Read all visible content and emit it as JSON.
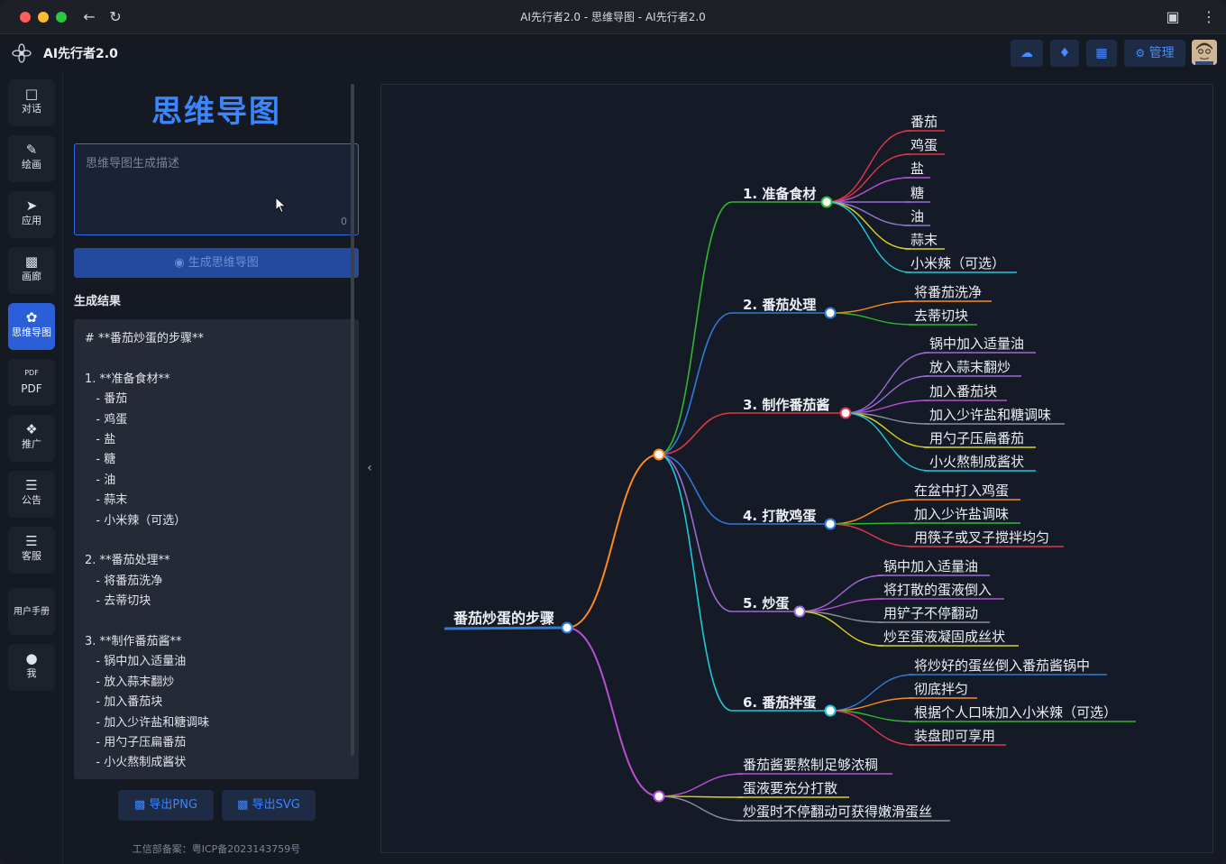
{
  "window": {
    "title": "AI先行者2.0 - 思维导图 - AI先行者2.0"
  },
  "app": {
    "name": "AI先行者2.0",
    "manage_label": "管理"
  },
  "nav": [
    {
      "label": "对话",
      "icon": "chat-icon"
    },
    {
      "label": "绘画",
      "icon": "brush-icon"
    },
    {
      "label": "应用",
      "icon": "rocket-icon"
    },
    {
      "label": "画廊",
      "icon": "gallery-icon"
    },
    {
      "label": "思维导图",
      "icon": "mindmap-icon",
      "active": true
    },
    {
      "label": "PDF",
      "icon": "pdf-icon"
    },
    {
      "label": "推广",
      "icon": "handshake-icon"
    },
    {
      "label": "公告",
      "icon": "notice-icon"
    },
    {
      "label": "客服",
      "icon": "service-icon"
    },
    {
      "label": "用户手册",
      "icon": "manual-icon"
    },
    {
      "label": "我",
      "icon": "user-icon"
    }
  ],
  "panel": {
    "title": "思维导图",
    "input_placeholder": "思维导图生成描述",
    "input_count": "0",
    "generate_label": "生成思维导图",
    "result_label": "生成结果",
    "result_lines": [
      "# **番茄炒蛋的步骤**",
      "",
      "1. **准备食材**",
      "   - 番茄",
      "   - 鸡蛋",
      "   - 盐",
      "   - 糖",
      "   - 油",
      "   - 蒜末",
      "   - 小米辣（可选）",
      "",
      "2. **番茄处理**",
      "   - 将番茄洗净",
      "   - 去蒂切块",
      "",
      "3. **制作番茄酱**",
      "   - 锅中加入适量油",
      "   - 放入蒜末翻炒",
      "   - 加入番茄块",
      "   - 加入少许盐和糖调味",
      "   - 用勺子压扁番茄",
      "   - 小火熬制成酱状"
    ],
    "export_png": "导出PNG",
    "export_svg": "导出SVG",
    "icp": "工信部备案：粤ICP备2023143759号"
  },
  "mindmap": {
    "root": "番茄炒蛋的步骤",
    "branches": [
      {
        "label": "1. 准备食材",
        "color": "#2eb82e",
        "children": [
          {
            "label": "番茄",
            "color": "#e0364a"
          },
          {
            "label": "鸡蛋",
            "color": "#e0364a"
          },
          {
            "label": "盐",
            "color": "#b84fd1"
          },
          {
            "label": "糖",
            "color": "#9a6bd6"
          },
          {
            "label": "油",
            "color": "#8c7ad0"
          },
          {
            "label": "蒜末",
            "color": "#d8d21e"
          },
          {
            "label": "小米辣（可选）",
            "color": "#1ec8d8"
          }
        ]
      },
      {
        "label": "2. 番茄处理",
        "color": "#2f7bd6",
        "children": [
          {
            "label": "将番茄洗净",
            "color": "#ff8a1e"
          },
          {
            "label": "去蒂切块",
            "color": "#2eb82e"
          }
        ]
      },
      {
        "label": "3. 制作番茄酱",
        "color": "#e0364a",
        "children": [
          {
            "label": "锅中加入适量油",
            "color": "#9a6bd6"
          },
          {
            "label": "放入蒜末翻炒",
            "color": "#9a6bd6"
          },
          {
            "label": "加入番茄块",
            "color": "#b84fd1"
          },
          {
            "label": "加入少许盐和糖调味",
            "color": "#8c8c99"
          },
          {
            "label": "用勺子压扁番茄",
            "color": "#d8d21e"
          },
          {
            "label": "小火熬制成酱状",
            "color": "#1ec8d8"
          }
        ]
      },
      {
        "label": "4. 打散鸡蛋",
        "color": "#2f7bd6",
        "children": [
          {
            "label": "在盆中打入鸡蛋",
            "color": "#ff8a1e"
          },
          {
            "label": "加入少许盐调味",
            "color": "#2eb82e"
          },
          {
            "label": "用筷子或叉子搅拌均匀",
            "color": "#e0364a"
          }
        ]
      },
      {
        "label": "5. 炒蛋",
        "color": "#9a6bd6",
        "children": [
          {
            "label": "锅中加入适量油",
            "color": "#9a6bd6"
          },
          {
            "label": "将打散的蛋液倒入",
            "color": "#b84fd1"
          },
          {
            "label": "用铲子不停翻动",
            "color": "#8c8c99"
          },
          {
            "label": "炒至蛋液凝固成丝状",
            "color": "#d8d21e"
          }
        ]
      },
      {
        "label": "6. 番茄拌蛋",
        "color": "#1ec8d8",
        "children": [
          {
            "label": "将炒好的蛋丝倒入番茄酱锅中",
            "color": "#2f7bd6"
          },
          {
            "label": "彻底拌匀",
            "color": "#ff8a1e"
          },
          {
            "label": "根据个人口味加入小米辣（可选）",
            "color": "#2eb82e"
          },
          {
            "label": "装盘即可享用",
            "color": "#e0364a"
          }
        ]
      },
      {
        "label": "",
        "color": "#b84fd1",
        "children": [
          {
            "label": "番茄酱要熬制足够浓稠",
            "color": "#b84fd1"
          },
          {
            "label": "蛋液要充分打散",
            "color": "#d8d21e"
          },
          {
            "label": "炒蛋时不停翻动可获得嫩滑蛋丝",
            "color": "#8c8c99"
          }
        ]
      }
    ]
  }
}
